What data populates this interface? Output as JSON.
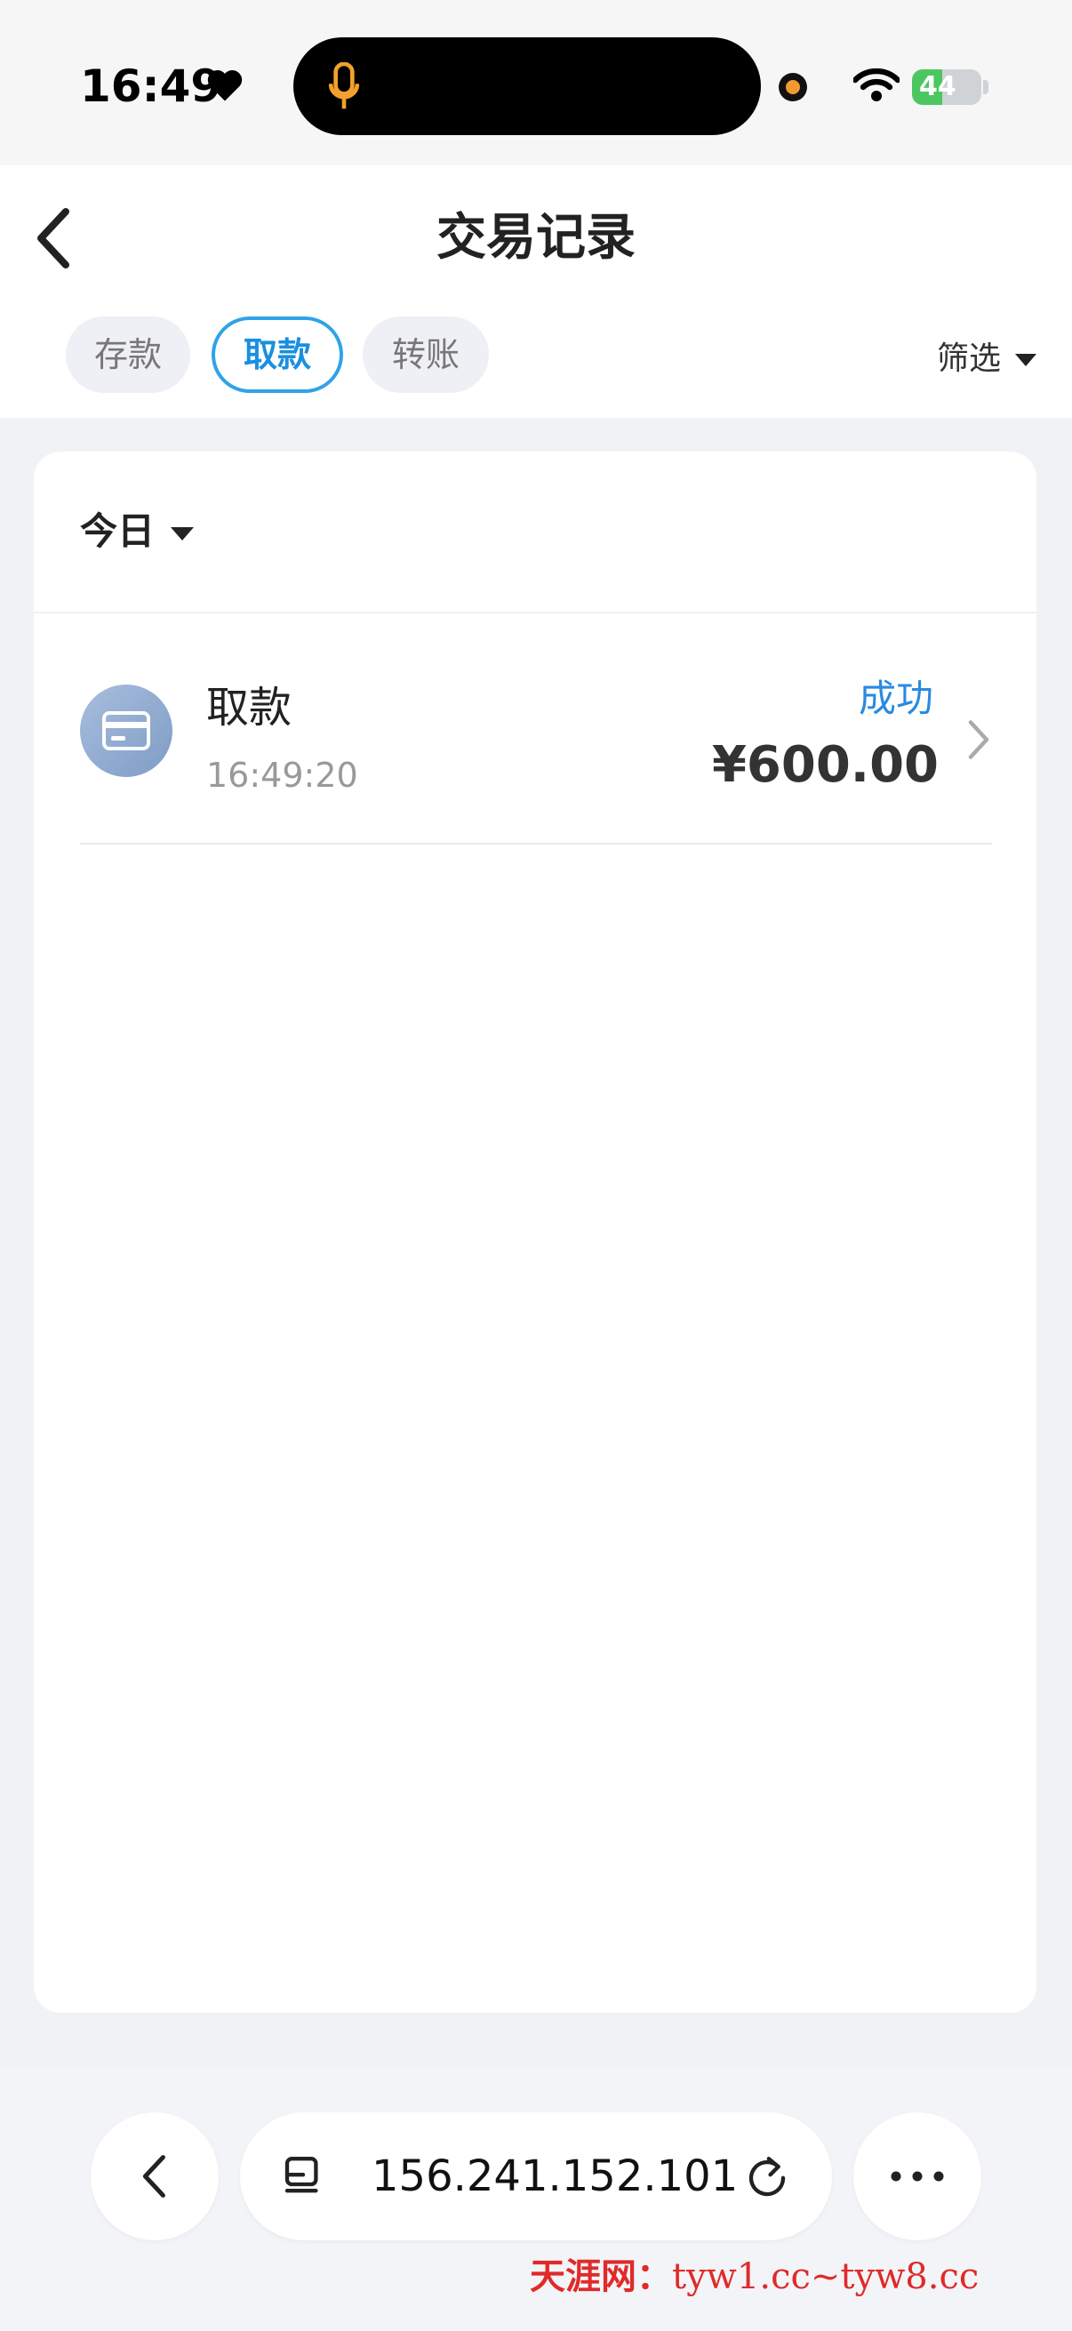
{
  "status_bar": {
    "time": "16:49",
    "battery": "44",
    "battery_level": 0.44
  },
  "header": {
    "title": "交易记录",
    "tabs": [
      {
        "label": "存款",
        "active": false
      },
      {
        "label": "取款",
        "active": true
      },
      {
        "label": "转账",
        "active": false
      }
    ],
    "filter_label": "筛选"
  },
  "list": {
    "date_filter": "今日",
    "records": [
      {
        "title": "取款",
        "time": "16:49:20",
        "status": "成功",
        "amount": "¥600.00",
        "icon": "card-icon"
      }
    ]
  },
  "browser": {
    "url": "156.241.152.101"
  },
  "watermark": {
    "brand": "天涯网：",
    "text": "tyw1.cc~tyw8.cc"
  },
  "colors": {
    "accent": "#1a8fe0",
    "status_success": "#2a8ae0",
    "watermark": "#e02a2a"
  }
}
